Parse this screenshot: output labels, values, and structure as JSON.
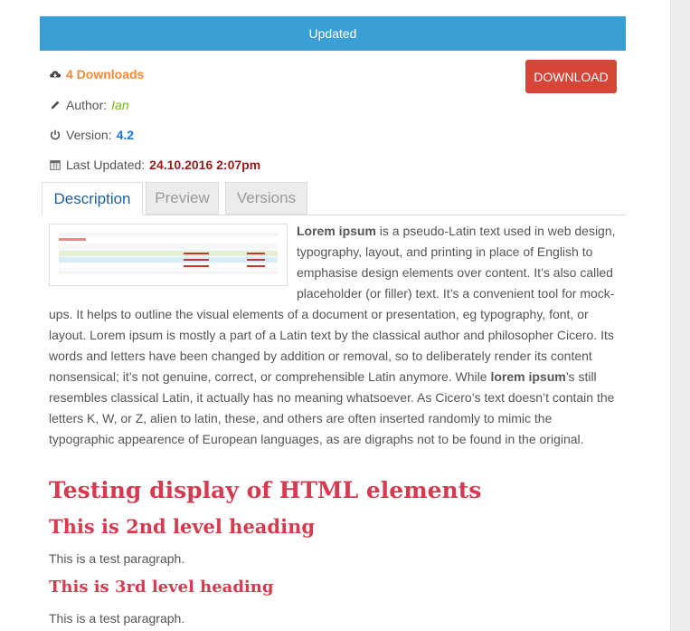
{
  "banner": {
    "text": "Updated"
  },
  "meta": {
    "downloads": "4 Downloads",
    "author_label": "Author:",
    "author_name": "Ian",
    "version_label": "Version:",
    "version_value": "4.2",
    "updated_label": "Last Updated:",
    "updated_value": "24.10.2016 2:07pm"
  },
  "download_button": "DOWNLOAD",
  "tabs": [
    {
      "label": "Description",
      "active": true
    },
    {
      "label": "Preview",
      "active": false
    },
    {
      "label": "Versions",
      "active": false
    }
  ],
  "description": {
    "p1_bold": "Lorem ipsum",
    "p1_a": " is a pseudo-Latin text used in web design, typography, layout, and printing in place of English to emphasise design elements over content. It’s also called placeholder (or filler) text. It’s a convenient tool for mock-ups. It helps to outline the visual elements of a document or presentation, eg typography, font, or layout. Lorem ipsum is mostly a part of a Latin text by the classical author and philosopher Cicero. Its words and letters have been changed by addition or removal, so to deliberately render its content nonsensical; it’s not genuine, correct, or comprehensible Latin anymore. While ",
    "p1_bold2": "lorem ipsum",
    "p1_b": "’s still resembles classical Latin, it actually has no meaning whatsoever. As Cicero’s text doesn’t contain the letters K, W, or Z, alien to latin, these, and others are often inserted randomly to mimic the typographic appearence of European languages, as are digraphs not to be found in the original."
  },
  "headings": {
    "h1": "Testing display of HTML elements",
    "h2": "This is 2nd level heading",
    "p2": "This is a test paragraph.",
    "h3": "This is 3rd level heading",
    "p3": "This is a test paragraph."
  },
  "colors": {
    "banner": "#3a9fd5",
    "download_button": "#d64538",
    "heading": "#d43b4f",
    "downloads": "#f5893b",
    "author": "#7ab51d",
    "version": "#1a73e8",
    "updated": "#9b1b1b"
  }
}
